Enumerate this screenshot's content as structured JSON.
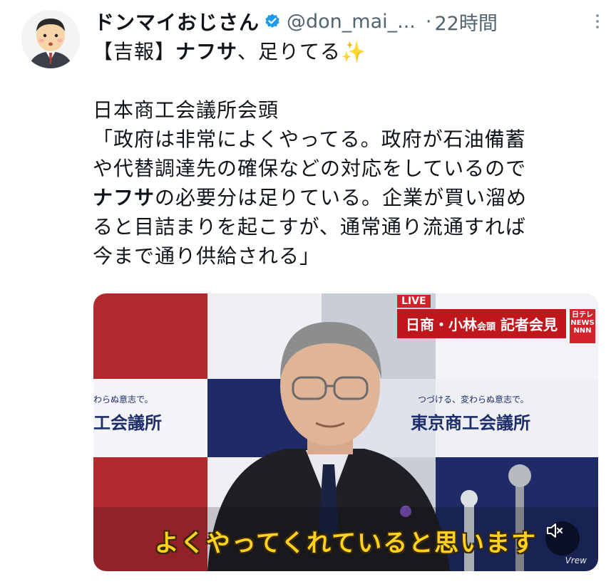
{
  "tweet": {
    "author": {
      "display_name": "ドンマイおじさん",
      "handle": "@don_mai_...",
      "verified": true
    },
    "separator": "·",
    "time": "22時間",
    "text": {
      "line1_a": "【吉報】",
      "line1_b": "ナフサ",
      "line1_c": "、足りてる",
      "sparkle": "✨",
      "para2_line1": "日本商工会議所会頭",
      "para2_line2": "「政府は非常によくやってる。政府が石油備蓄",
      "para2_line3": "や代替調達先の確保などの対応をしているので",
      "para2_line4_bold": "ナフサ",
      "para2_line4_rest": "の必要分は足りている。企業が買い溜め",
      "para2_line5": "ると目詰まりを起こすが、通常通り流通すれば",
      "para2_line6": "今まで通り供給される」"
    },
    "media": {
      "caption": "よくやってくれていると思います",
      "live_label": "LIVE",
      "headline": "日商・小林",
      "headline_small": "会頭",
      "headline_tail": "記者会見",
      "logo_text": "日テレ NEWS NNN",
      "wall_left": "工会議所",
      "wall_left_slogan": "わらぬ意志で。",
      "wall_right": "東京商工会議所",
      "wall_right_slogan": "つづける、変わらぬ意志で。",
      "watermark": "Vrew"
    }
  },
  "icons": {
    "avatar": "cartoon-man-avatar",
    "verified": "verified-badge-icon",
    "more": "more-vertical-icon",
    "mute": "speaker-muted-icon"
  },
  "colors": {
    "verified": "#1d9bf0",
    "secondary_text": "#536471",
    "caption": "#ffd21f",
    "news_red": "#c0171d"
  }
}
